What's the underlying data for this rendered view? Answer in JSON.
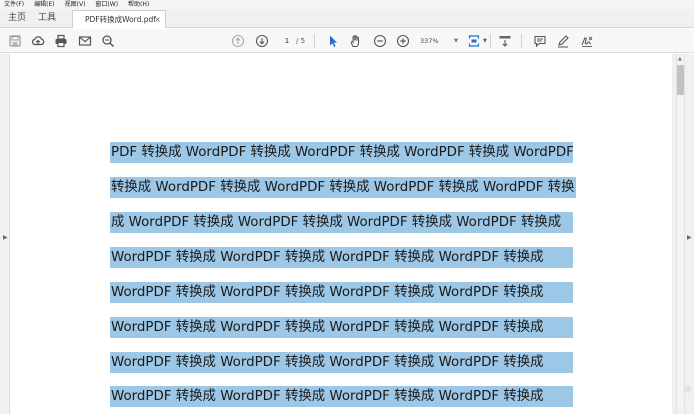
{
  "menu": [
    "文件(F)",
    "编辑(E)",
    "视图(V)",
    "窗口(W)",
    "帮助(H)"
  ],
  "nav": {
    "home": "主页",
    "tools": "工具"
  },
  "tab": {
    "title": "PDF转换成Word.pdf",
    "close": "×"
  },
  "toolbar": {
    "page_current": "1",
    "page_total": "/ 5",
    "zoom": "337%",
    "icons": [
      "save-icon",
      "cloud-upload-icon",
      "print-icon",
      "email-icon",
      "search-icon",
      "page-up-icon",
      "page-down-icon",
      "select-cursor-icon",
      "hand-icon",
      "zoom-out-icon",
      "zoom-in-icon",
      "fit-page-icon",
      "scroll-mode-icon",
      "comment-icon",
      "highlight-pen-icon",
      "sign-icon"
    ]
  },
  "document": {
    "lines": [
      "PDF 转换成 WordPDF 转换成 WordPDF 转换成 WordPDF 转换成 WordPDF",
      "转换成 WordPDF 转换成 WordPDF 转换成 WordPDF 转换成 WordPDF 转换",
      "成 WordPDF 转换成 WordPDF 转换成 WordPDF 转换成 WordPDF 转换成",
      "WordPDF 转换成 WordPDF 转换成 WordPDF 转换成 WordPDF 转换成",
      "WordPDF 转换成 WordPDF 转换成 WordPDF 转换成 WordPDF 转换成",
      "WordPDF 转换成 WordPDF 转换成 WordPDF 转换成 WordPDF 转换成",
      "WordPDF 转换成 WordPDF 转换成 WordPDF 转换成 WordPDF 转换成",
      "WordPDF 转换成 WordPDF 转换成 WordPDF 转换成 WordPDF 转换成"
    ],
    "selection_color": "#9cc7e6"
  },
  "watermark": "溴"
}
